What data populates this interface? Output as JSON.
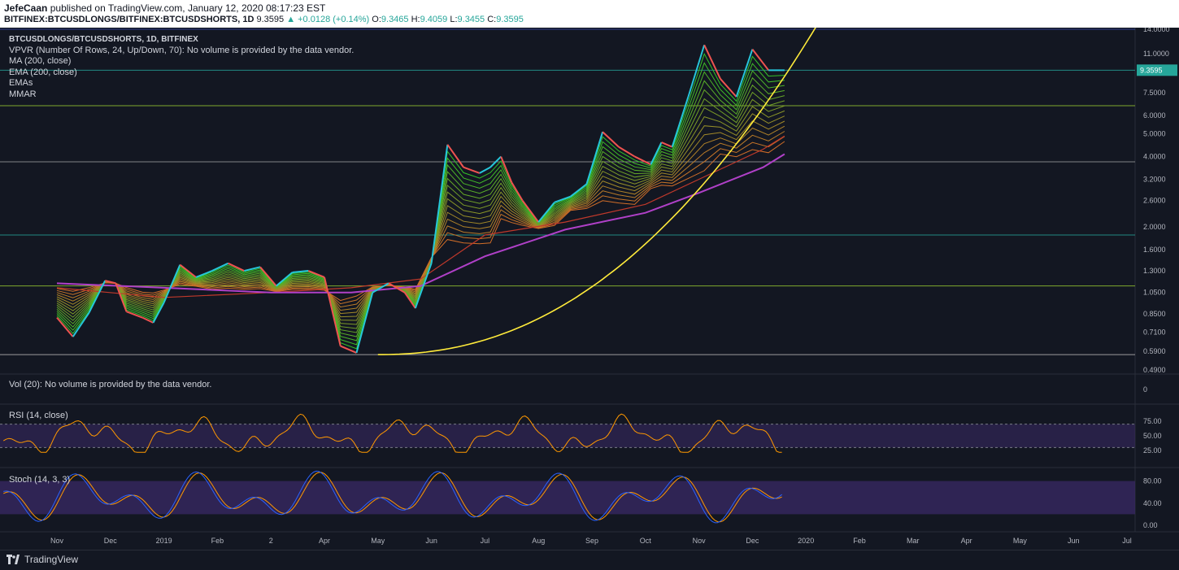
{
  "header": {
    "author": "JefeCaan",
    "published_text": "published on TradingView.com, January 12, 2020 08:17:23 EST",
    "symbol": "BITFINEX:BTCUSDLONGS/BITFINEX:BTCUSDSHORTS, 1D",
    "last": "9.3595",
    "change": "▲ +0.0128 (+0.14%)",
    "o_label": "O:",
    "o": "9.3465",
    "h_label": "H:",
    "h": "9.4059",
    "l_label": "L:",
    "l": "9.3455",
    "c_label": "C:",
    "c": "9.3595"
  },
  "legend": {
    "title": "BTCUSDLONGS/BTCUSDSHORTS, 1D, BITFINEX",
    "vpvr": "VPVR (Number Of Rows, 24, Up/Down, 70): No volume is provided by the data vendor.",
    "ma": "MA (200, close)",
    "ema": "EMA (200, close)",
    "emas": "EMAs",
    "mmar": "MMAR"
  },
  "volume_label": "Vol (20): No volume is provided by the data vendor.",
  "volume_axis_label": "0",
  "rsi_label": "RSI (14, close)",
  "stoch_label": "Stoch (14, 3, 3)",
  "footer": {
    "brand": "TradingView"
  },
  "colors": {
    "background": "#131722",
    "up_candle": "#26c6da",
    "down_candle": "#ef5350",
    "ma200": "#b040c8",
    "ema200": "#c0392b",
    "parabola": "#ffeb3b",
    "rsi": "#ff9800",
    "stoch_k": "#2962ff",
    "stoch_d": "#ff9800",
    "band": "#3a2a66",
    "last_price_tag": "#26a69a"
  },
  "chart_data": {
    "type": "line",
    "title": "BTCUSDLONGS/BTCUSDSHORTS, 1D, BITFINEX",
    "scale": "log",
    "x_axis_labels": [
      "Nov",
      "Dec",
      "2019",
      "Feb",
      "2",
      "Apr",
      "May",
      "Jun",
      "Jul",
      "Aug",
      "Sep",
      "Oct",
      "Nov",
      "Dec",
      "2020",
      "Feb",
      "Mar",
      "Apr",
      "May",
      "Jun",
      "Jul"
    ],
    "price_axis_ticks": [
      "14.0000",
      "11.0000",
      "7.5000",
      "6.0000",
      "5.0000",
      "4.0000",
      "3.2000",
      "2.6000",
      "2.0000",
      "1.6000",
      "1.3000",
      "1.0500",
      "0.8500",
      "0.7100",
      "0.5900",
      "0.4900"
    ],
    "price_axis_values": [
      14.0,
      11.0,
      7.5,
      6.0,
      5.0,
      4.0,
      3.2,
      2.6,
      2.0,
      1.6,
      1.3,
      1.05,
      0.85,
      0.71,
      0.59,
      0.49
    ],
    "last_price": 9.3595,
    "last_price_label": "9.3595",
    "series": [
      {
        "name": "BTCUSDLONGS/BTCUSDSHORTS",
        "x_month_index": [
          0,
          0.3,
          0.6,
          0.9,
          1.1,
          1.3,
          1.6,
          1.8,
          2.0,
          2.3,
          2.6,
          2.9,
          3.2,
          3.5,
          3.8,
          4.1,
          4.4,
          4.7,
          5.0,
          5.3,
          5.6,
          5.9,
          6.2,
          6.5,
          6.7,
          7.0,
          7.3,
          7.6,
          7.9,
          8.1,
          8.3,
          8.5,
          8.7,
          9.0,
          9.3,
          9.6,
          9.9,
          10.2,
          10.5,
          10.8,
          11.1,
          11.3,
          11.5,
          11.8,
          12.1,
          12.4,
          12.7,
          13.0,
          13.3,
          13.6
        ],
        "close": [
          0.82,
          0.68,
          0.86,
          1.18,
          1.15,
          0.87,
          0.82,
          0.78,
          0.95,
          1.38,
          1.22,
          1.3,
          1.4,
          1.3,
          1.35,
          1.12,
          1.28,
          1.3,
          1.22,
          0.62,
          0.58,
          1.05,
          1.15,
          1.05,
          0.9,
          1.4,
          4.5,
          3.6,
          3.4,
          3.6,
          4.0,
          3.1,
          2.6,
          2.1,
          2.55,
          2.7,
          3.05,
          5.1,
          4.4,
          4.0,
          3.7,
          4.6,
          4.4,
          7.2,
          12.0,
          8.6,
          7.2,
          11.5,
          9.36,
          9.36
        ]
      },
      {
        "name": "MA (200, close)",
        "x_month_index": [
          0,
          2,
          4,
          5.5,
          6.8,
          8.0,
          9.5,
          11.0,
          12.0,
          13.2,
          13.6
        ],
        "values": [
          1.15,
          1.1,
          1.05,
          1.05,
          1.12,
          1.5,
          1.95,
          2.3,
          2.8,
          3.6,
          4.1
        ]
      },
      {
        "name": "EMA (200, close)",
        "x_month_index": [
          0,
          2,
          4,
          5.5,
          6.8,
          8.0,
          9.5,
          11.0,
          12.0,
          13.2,
          13.6
        ],
        "values": [
          1.1,
          1.0,
          1.05,
          1.1,
          1.2,
          1.85,
          2.1,
          2.5,
          3.2,
          4.3,
          4.9
        ]
      }
    ],
    "rsi": {
      "levels": [
        25,
        50,
        75
      ],
      "band": [
        30,
        70
      ],
      "ticks": [
        "75.00",
        "50.00",
        "25.00"
      ]
    },
    "stoch": {
      "levels": [
        0,
        40,
        80
      ],
      "band": [
        20,
        80
      ],
      "ticks": [
        "80.00",
        "40.00",
        "0.00"
      ]
    },
    "volume_ticks": [
      "0"
    ]
  }
}
